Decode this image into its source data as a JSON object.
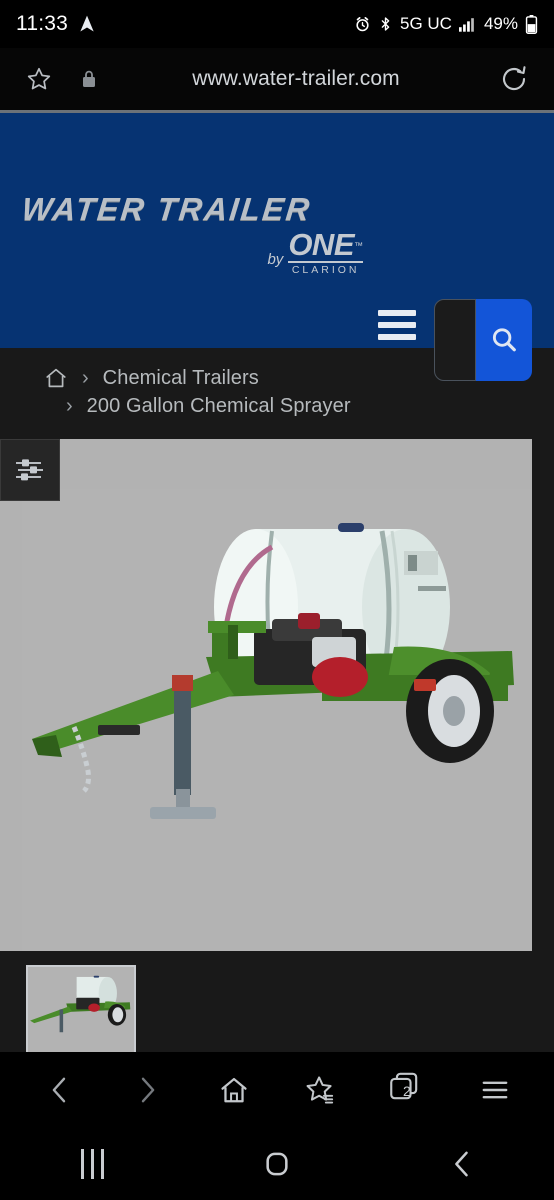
{
  "status_bar": {
    "time": "11:33",
    "network_label": "5G UC",
    "battery_percent": "49%",
    "icons": [
      "navigation-arrow-icon",
      "alarm-icon",
      "bluetooth-icon",
      "signal-bars-icon",
      "battery-icon"
    ]
  },
  "browser": {
    "url": "www.water-trailer.com",
    "icons": {
      "bookmark": "star-icon",
      "security": "lock-icon",
      "reload": "refresh-icon"
    },
    "toolbar": {
      "back": "back-arrow-icon",
      "forward": "forward-arrow-icon",
      "home": "home-icon",
      "bookmarks": "star-list-icon",
      "tabs": "tabs-icon",
      "tab_count": "2",
      "menu": "hamburger-menu-icon"
    }
  },
  "android_nav": {
    "recents": "recents-icon",
    "home": "home-square-icon",
    "back": "back-chevron-icon"
  },
  "site": {
    "header": {
      "logo_main": "WATER TRAILER",
      "logo_by": "by",
      "logo_brand": "ONE",
      "logo_tm": "™",
      "logo_subbrand": "CLARION",
      "menu_icon": "hamburger-menu-icon",
      "search_placeholder": "",
      "search_value": "",
      "search_icon": "search-icon",
      "background_color": "#063372",
      "search_button_color": "#1355d8"
    },
    "breadcrumb": {
      "home_icon": "home-icon",
      "separator": "›",
      "items": [
        {
          "label": "Chemical Trailers"
        },
        {
          "label": "200 Gallon Chemical Sprayer"
        }
      ]
    },
    "gallery": {
      "filter_icon": "sliders-icon",
      "main_image_alt": "200 Gallon Chemical Sprayer trailer",
      "thumbnails": [
        {
          "alt": "200 Gallon Chemical Sprayer trailer thumbnail"
        }
      ]
    }
  }
}
